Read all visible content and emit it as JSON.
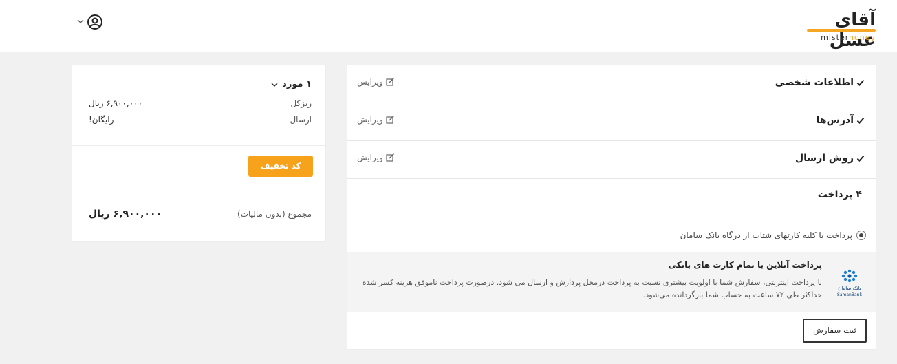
{
  "header": {
    "logo_fa": "آقای عسل",
    "logo_en_prefix": "mister",
    "logo_en_suffix": "honey",
    "brand_color": "#f5a623"
  },
  "summary": {
    "items_count": "۱ مورد",
    "rows": [
      {
        "label": "ریزکل",
        "value": "۶,۹۰۰,۰۰۰ ریال"
      },
      {
        "label": "ارسال",
        "value": "رایگان!"
      }
    ],
    "discount_button": "کد تخفیف",
    "total_label": "مجموع (بدون مالیات)",
    "total_value": "۶,۹۰۰,۰۰۰ ریال"
  },
  "steps": [
    {
      "title": "اطلاعات شخصی",
      "edit": "ویرایش"
    },
    {
      "title": "آدرس‌ها",
      "edit": "ویرایش"
    },
    {
      "title": "روش ارسال",
      "edit": "ویرایش"
    }
  ],
  "payment": {
    "title": "۴ پرداخت",
    "option_label": "پرداخت با کلیه کارتهای شتاب از درگاه بانک سامان",
    "gateway_title": "پرداخت آنلاین با تمام کارت های بانکی",
    "gateway_desc": "با پرداخت اینترنتی، سفارش شما با اولویت بیشتری نسبت به پرداخت درمحل پردازش و ارسال می شود. درصورت پرداخت ناموفق هزینه کسر شده حداکثر طی ۷۲ ساعت به حساب شما بازگردانده می‌شود.",
    "bank_name_fa": "بانک سامان",
    "bank_name_en": "SamanBank",
    "submit_button": "ثبت سفارش"
  },
  "icons": {
    "user": "user-circle-icon",
    "chevron": "chevron-down-icon",
    "check": "check-icon",
    "edit": "edit-icon"
  }
}
